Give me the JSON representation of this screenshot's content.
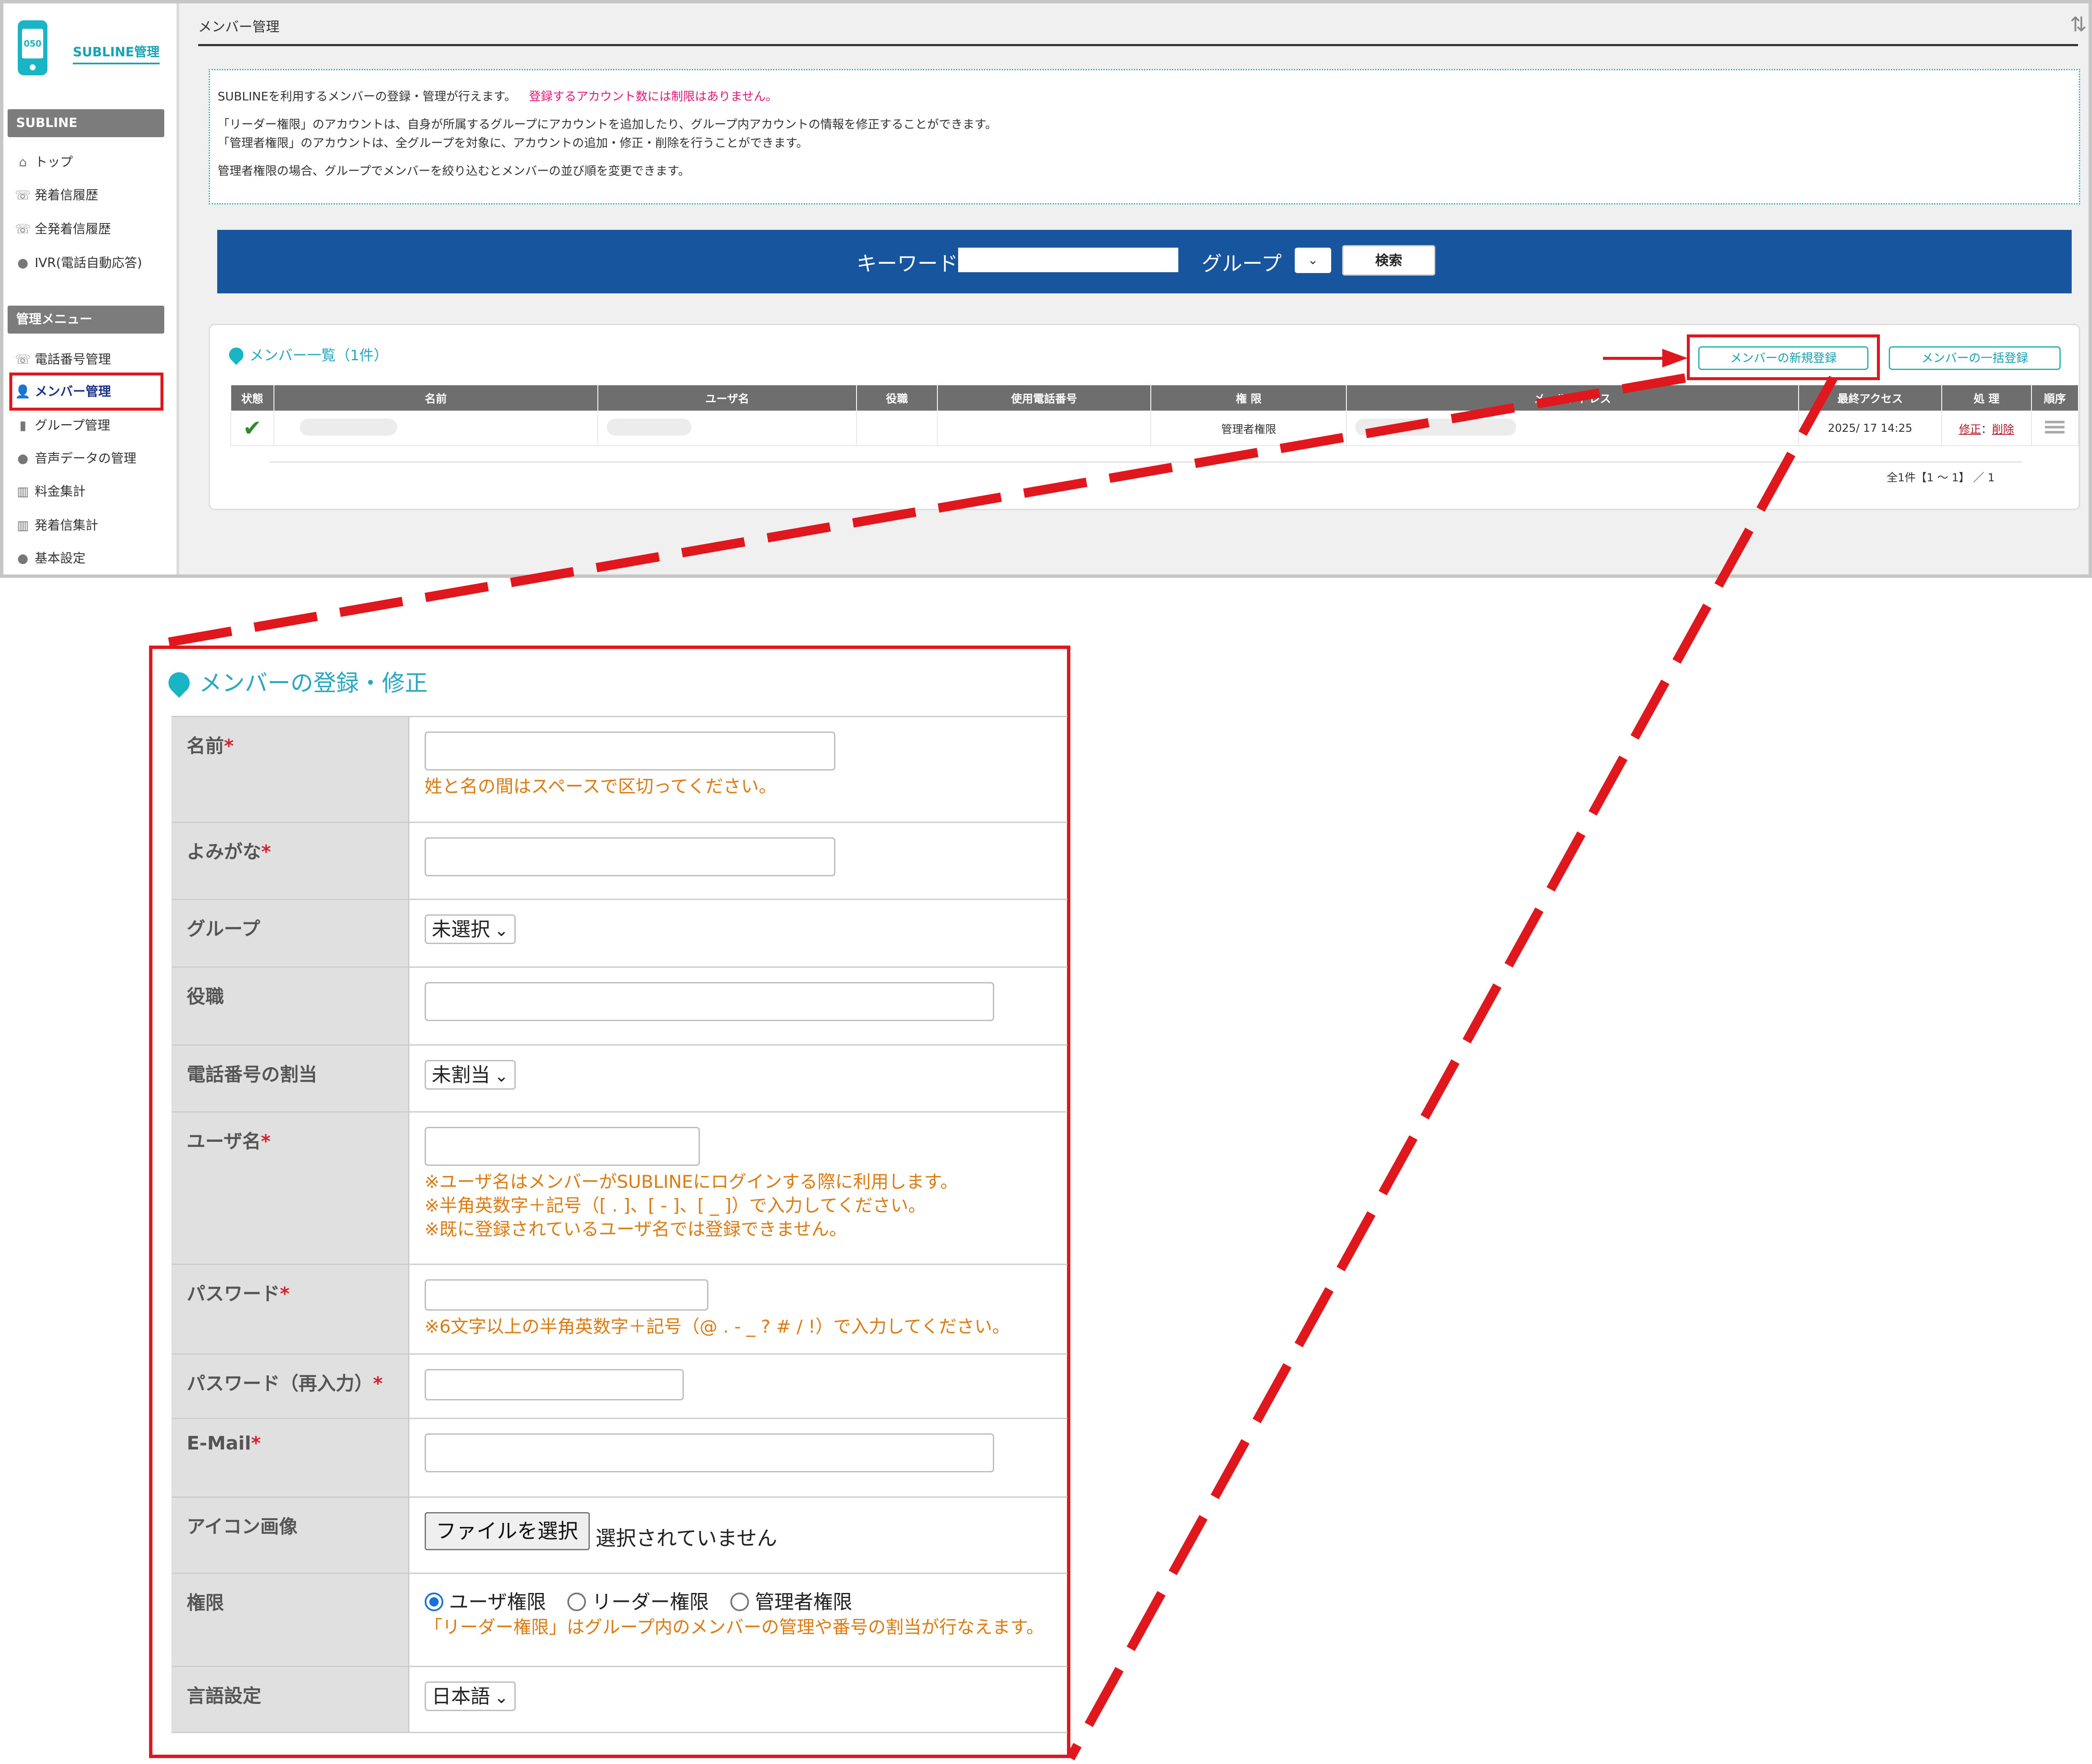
{
  "app": {
    "logo_text": "SUBLINE管理",
    "logo_screen": "050",
    "page_title": "メンバー管理"
  },
  "sidebar": {
    "section1": "SUBLINE",
    "items1": [
      {
        "label": "トップ",
        "icon": "home-icon"
      },
      {
        "label": "発着信履歴",
        "icon": "phone-icon"
      },
      {
        "label": "全発着信履歴",
        "icon": "phone-icon"
      },
      {
        "label": "IVR(電話自動応答)",
        "icon": "chat-icon"
      }
    ],
    "section2": "管理メニュー",
    "items2": [
      {
        "label": "電話番号管理",
        "icon": "phone-icon"
      },
      {
        "label": "メンバー管理",
        "icon": "user-icon"
      },
      {
        "label": "グループ管理",
        "icon": "group-icon"
      },
      {
        "label": "音声データの管理",
        "icon": "chat-icon"
      },
      {
        "label": "料金集計",
        "icon": "chart-icon"
      },
      {
        "label": "発着信集計",
        "icon": "chart-icon"
      },
      {
        "label": "基本設定",
        "icon": "chat-icon"
      }
    ]
  },
  "info": {
    "line1": "SUBLINEを利用するメンバーの登録・管理が行えます。",
    "line1_note": "登録するアカウント数には制限はありません。",
    "line2": "「リーダー権限」のアカウントは、自身が所属するグループにアカウントを追加したり、グループ内アカウントの情報を修正することができます。",
    "line3": "「管理者権限」のアカウントは、全グループを対象に、アカウントの追加・修正・削除を行うことができます。",
    "line4": "管理者権限の場合、グループでメンバーを絞り込むとメンバーの並び順を変更できます。"
  },
  "search": {
    "keyword_label": "キーワード",
    "group_label": "グループ",
    "button": "検索"
  },
  "list": {
    "title": "メンバー一覧（1件）",
    "new_button": "メンバーの新規登録",
    "bulk_button": "メンバーの一括登録",
    "columns": [
      "状態",
      "名前",
      "ユーザ名",
      "役職",
      "使用電話番号",
      "権 限",
      "メールアドレス",
      "最終アクセス",
      "処 理",
      "順序"
    ],
    "row": {
      "role": "管理者権限",
      "last_access": "2025/ 17 14:25",
      "edit": "修正",
      "sep": "：",
      "delete": "削除"
    },
    "pager": "全1件【1 ～ 1】 ／ 1"
  },
  "form": {
    "title": "メンバーの登録・修正",
    "name_label": "名前",
    "name_hint": "姓と名の間はスペースで区切ってください。",
    "kana_label": "よみがな",
    "group_label": "グループ",
    "group_value": "未選択",
    "position_label": "役職",
    "phone_label": "電話番号の割当",
    "phone_value": "未割当",
    "username_label": "ユーザ名",
    "username_hint1": "※ユーザ名はメンバーがSUBLINEにログインする際に利用します。",
    "username_hint2": "※半角英数字＋記号（[ . ]、[ - ]、[ _ ]）で入力してください。",
    "username_hint3": "※既に登録されているユーザ名では登録できません。",
    "password_label": "パスワード",
    "password_hint": "※6文字以上の半角英数字＋記号（@ . - _ ? # / !）で入力してください。",
    "password2_label": "パスワード（再入力）",
    "email_label": "E-Mail",
    "icon_label": "アイコン画像",
    "file_button": "ファイルを選択",
    "file_status": "選択されていません",
    "auth_label": "権限",
    "auth_user": "ユーザ権限",
    "auth_leader": "リーダー権限",
    "auth_admin": "管理者権限",
    "auth_hint": "「リーダー権限」はグループ内のメンバーの管理や番号の割当が行なえます。",
    "lang_label": "言語設定",
    "lang_value": "日本語",
    "required_mark": "*"
  },
  "colors": {
    "accent": "#19b5c4",
    "search_bar": "#17569e",
    "highlight": "#e0181e",
    "hint": "#dc7b10"
  }
}
